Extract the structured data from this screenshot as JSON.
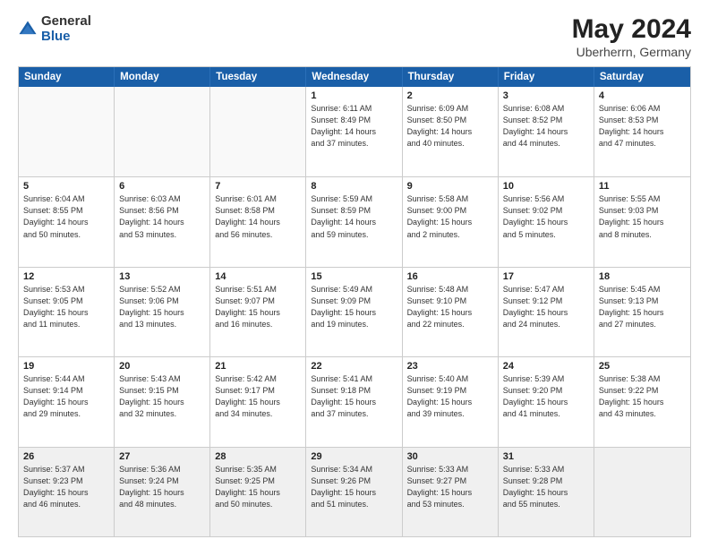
{
  "header": {
    "logo_general": "General",
    "logo_blue": "Blue",
    "main_title": "May 2024",
    "subtitle": "Uberherrn, Germany"
  },
  "weekdays": [
    "Sunday",
    "Monday",
    "Tuesday",
    "Wednesday",
    "Thursday",
    "Friday",
    "Saturday"
  ],
  "weeks": [
    [
      {
        "day": "",
        "info": ""
      },
      {
        "day": "",
        "info": ""
      },
      {
        "day": "",
        "info": ""
      },
      {
        "day": "1",
        "info": "Sunrise: 6:11 AM\nSunset: 8:49 PM\nDaylight: 14 hours\nand 37 minutes."
      },
      {
        "day": "2",
        "info": "Sunrise: 6:09 AM\nSunset: 8:50 PM\nDaylight: 14 hours\nand 40 minutes."
      },
      {
        "day": "3",
        "info": "Sunrise: 6:08 AM\nSunset: 8:52 PM\nDaylight: 14 hours\nand 44 minutes."
      },
      {
        "day": "4",
        "info": "Sunrise: 6:06 AM\nSunset: 8:53 PM\nDaylight: 14 hours\nand 47 minutes."
      }
    ],
    [
      {
        "day": "5",
        "info": "Sunrise: 6:04 AM\nSunset: 8:55 PM\nDaylight: 14 hours\nand 50 minutes."
      },
      {
        "day": "6",
        "info": "Sunrise: 6:03 AM\nSunset: 8:56 PM\nDaylight: 14 hours\nand 53 minutes."
      },
      {
        "day": "7",
        "info": "Sunrise: 6:01 AM\nSunset: 8:58 PM\nDaylight: 14 hours\nand 56 minutes."
      },
      {
        "day": "8",
        "info": "Sunrise: 5:59 AM\nSunset: 8:59 PM\nDaylight: 14 hours\nand 59 minutes."
      },
      {
        "day": "9",
        "info": "Sunrise: 5:58 AM\nSunset: 9:00 PM\nDaylight: 15 hours\nand 2 minutes."
      },
      {
        "day": "10",
        "info": "Sunrise: 5:56 AM\nSunset: 9:02 PM\nDaylight: 15 hours\nand 5 minutes."
      },
      {
        "day": "11",
        "info": "Sunrise: 5:55 AM\nSunset: 9:03 PM\nDaylight: 15 hours\nand 8 minutes."
      }
    ],
    [
      {
        "day": "12",
        "info": "Sunrise: 5:53 AM\nSunset: 9:05 PM\nDaylight: 15 hours\nand 11 minutes."
      },
      {
        "day": "13",
        "info": "Sunrise: 5:52 AM\nSunset: 9:06 PM\nDaylight: 15 hours\nand 13 minutes."
      },
      {
        "day": "14",
        "info": "Sunrise: 5:51 AM\nSunset: 9:07 PM\nDaylight: 15 hours\nand 16 minutes."
      },
      {
        "day": "15",
        "info": "Sunrise: 5:49 AM\nSunset: 9:09 PM\nDaylight: 15 hours\nand 19 minutes."
      },
      {
        "day": "16",
        "info": "Sunrise: 5:48 AM\nSunset: 9:10 PM\nDaylight: 15 hours\nand 22 minutes."
      },
      {
        "day": "17",
        "info": "Sunrise: 5:47 AM\nSunset: 9:12 PM\nDaylight: 15 hours\nand 24 minutes."
      },
      {
        "day": "18",
        "info": "Sunrise: 5:45 AM\nSunset: 9:13 PM\nDaylight: 15 hours\nand 27 minutes."
      }
    ],
    [
      {
        "day": "19",
        "info": "Sunrise: 5:44 AM\nSunset: 9:14 PM\nDaylight: 15 hours\nand 29 minutes."
      },
      {
        "day": "20",
        "info": "Sunrise: 5:43 AM\nSunset: 9:15 PM\nDaylight: 15 hours\nand 32 minutes."
      },
      {
        "day": "21",
        "info": "Sunrise: 5:42 AM\nSunset: 9:17 PM\nDaylight: 15 hours\nand 34 minutes."
      },
      {
        "day": "22",
        "info": "Sunrise: 5:41 AM\nSunset: 9:18 PM\nDaylight: 15 hours\nand 37 minutes."
      },
      {
        "day": "23",
        "info": "Sunrise: 5:40 AM\nSunset: 9:19 PM\nDaylight: 15 hours\nand 39 minutes."
      },
      {
        "day": "24",
        "info": "Sunrise: 5:39 AM\nSunset: 9:20 PM\nDaylight: 15 hours\nand 41 minutes."
      },
      {
        "day": "25",
        "info": "Sunrise: 5:38 AM\nSunset: 9:22 PM\nDaylight: 15 hours\nand 43 minutes."
      }
    ],
    [
      {
        "day": "26",
        "info": "Sunrise: 5:37 AM\nSunset: 9:23 PM\nDaylight: 15 hours\nand 46 minutes."
      },
      {
        "day": "27",
        "info": "Sunrise: 5:36 AM\nSunset: 9:24 PM\nDaylight: 15 hours\nand 48 minutes."
      },
      {
        "day": "28",
        "info": "Sunrise: 5:35 AM\nSunset: 9:25 PM\nDaylight: 15 hours\nand 50 minutes."
      },
      {
        "day": "29",
        "info": "Sunrise: 5:34 AM\nSunset: 9:26 PM\nDaylight: 15 hours\nand 51 minutes."
      },
      {
        "day": "30",
        "info": "Sunrise: 5:33 AM\nSunset: 9:27 PM\nDaylight: 15 hours\nand 53 minutes."
      },
      {
        "day": "31",
        "info": "Sunrise: 5:33 AM\nSunset: 9:28 PM\nDaylight: 15 hours\nand 55 minutes."
      },
      {
        "day": "",
        "info": ""
      }
    ]
  ]
}
